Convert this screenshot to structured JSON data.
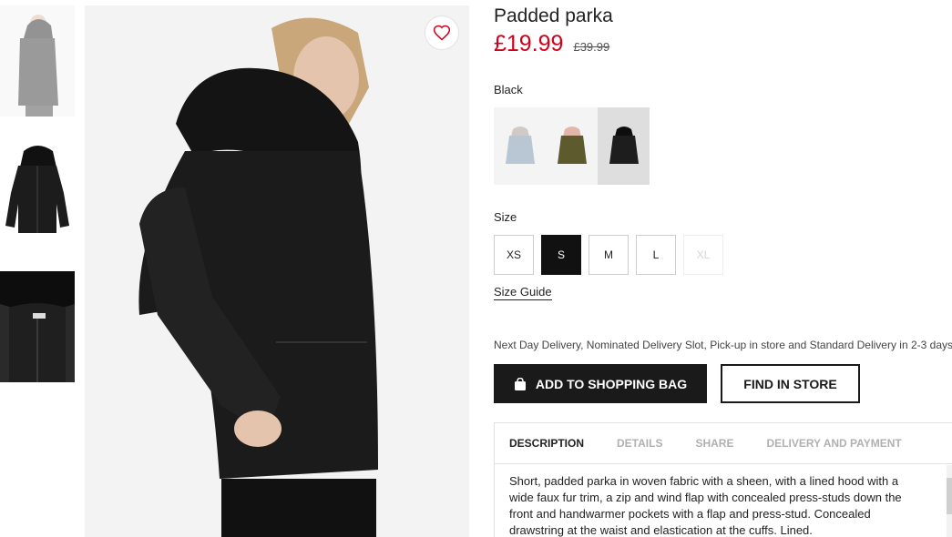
{
  "product": {
    "title": "Padded parka",
    "price": "£19.99",
    "original_price": "£39.99",
    "color_name": "Black"
  },
  "colors": {
    "swatches": [
      {
        "name": "light-blue",
        "fill": "#b9c6d4",
        "fur": "#cfcac5"
      },
      {
        "name": "khaki",
        "fill": "#5d5a2e",
        "fur": "#e0b7a8"
      },
      {
        "name": "black",
        "fill": "#1d1d1d",
        "fur": "#222222"
      }
    ],
    "selected_index": 2
  },
  "size": {
    "label": "Size",
    "options": [
      "XS",
      "S",
      "M",
      "L",
      "XL"
    ],
    "selected": "S",
    "unavailable": [
      "XL"
    ],
    "guide_label": "Size Guide"
  },
  "delivery_text": "Next Day Delivery, Nominated Delivery Slot, Pick-up in store and Standard Delivery in 2-3 days.",
  "buttons": {
    "add_to_bag": "ADD TO SHOPPING BAG",
    "find_in_store": "FIND IN STORE"
  },
  "tabs": {
    "items": [
      "DESCRIPTION",
      "DETAILS",
      "SHARE",
      "DELIVERY AND PAYMENT"
    ],
    "active": "DESCRIPTION"
  },
  "description": "Short, padded parka in woven fabric with a sheen, with a lined hood with a wide faux fur trim, a zip and wind flap with concealed press-studs down the front and handwarmer pockets with a flap and press-stud. Concealed drawstring at the waist and elastication at the cuffs. Lined.",
  "colors_theme": {
    "sale_red": "#d0021b",
    "button_black": "#1a1a1a"
  },
  "icons": {
    "favourite": "heart-icon",
    "bag": "shopping-bag-icon"
  }
}
